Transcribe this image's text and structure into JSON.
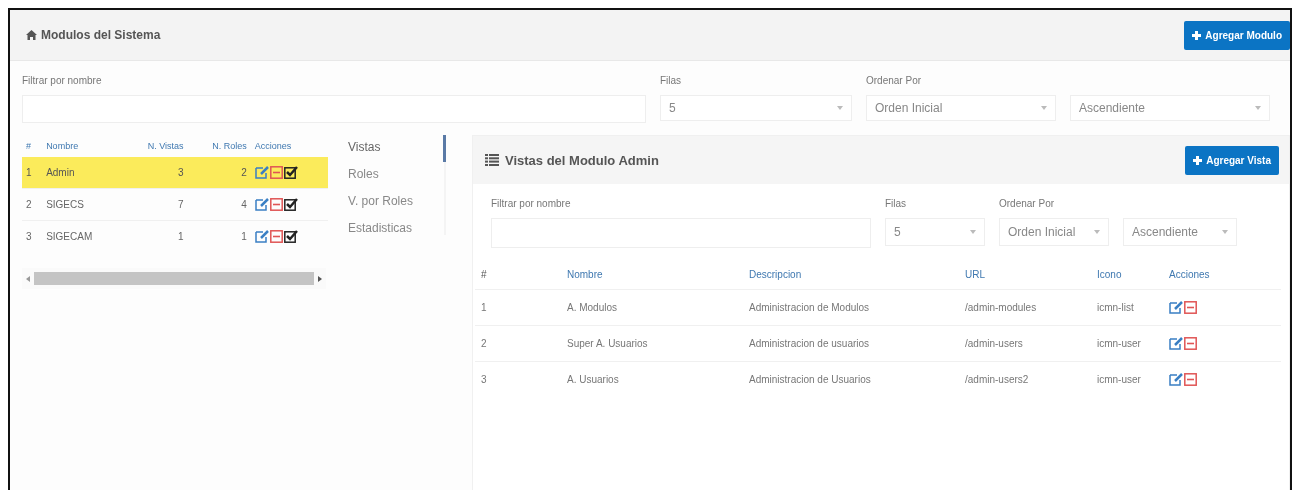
{
  "header": {
    "title": "Modulos del Sistema",
    "add_button": "Agregar Modulo"
  },
  "filters": {
    "name_label": "Filtrar por nombre",
    "rows_label": "Filas",
    "rows_value": "5",
    "order_label": "Ordenar Por",
    "order_value": "Orden Inicial",
    "direction_value": "Ascendiente"
  },
  "modules_table": {
    "columns": [
      "#",
      "Nombre",
      "N. Vistas",
      "N. Roles",
      "Acciones"
    ],
    "rows": [
      {
        "cells": [
          "1",
          "Admin",
          "3",
          "2"
        ],
        "selected": true
      },
      {
        "cells": [
          "2",
          "SIGECS",
          "7",
          "4"
        ],
        "selected": false
      },
      {
        "cells": [
          "3",
          "SIGECAM",
          "1",
          "1"
        ],
        "selected": false
      }
    ]
  },
  "tabs": [
    {
      "label": "Vistas",
      "selected": true
    },
    {
      "label": "Roles",
      "selected": false
    },
    {
      "label": "V. por Roles",
      "selected": false
    },
    {
      "label": "Estadisticas",
      "selected": false
    }
  ],
  "views_panel": {
    "title": "Vistas del Modulo Admin",
    "add_button": "Agregar Vista",
    "filters": {
      "name_label": "Filtrar por nombre",
      "rows_label": "Filas",
      "rows_value": "5",
      "order_label": "Ordenar Por",
      "order_value": "Orden Inicial",
      "direction_value": "Ascendiente"
    },
    "table": {
      "columns": [
        "#",
        "Nombre",
        "Descripcion",
        "URL",
        "Icono",
        "Acciones"
      ],
      "rows": [
        [
          "1",
          "A. Modulos",
          "Administracion de Modulos",
          "/admin-modules",
          "icmn-list"
        ],
        [
          "2",
          "Super A. Usuarios",
          "Administracion de usuarios",
          "/admin-users",
          "icmn-user"
        ],
        [
          "3",
          "A. Usuarios",
          "Administracion de Usuarios",
          "/admin-users2",
          "icmn-user"
        ]
      ]
    }
  }
}
